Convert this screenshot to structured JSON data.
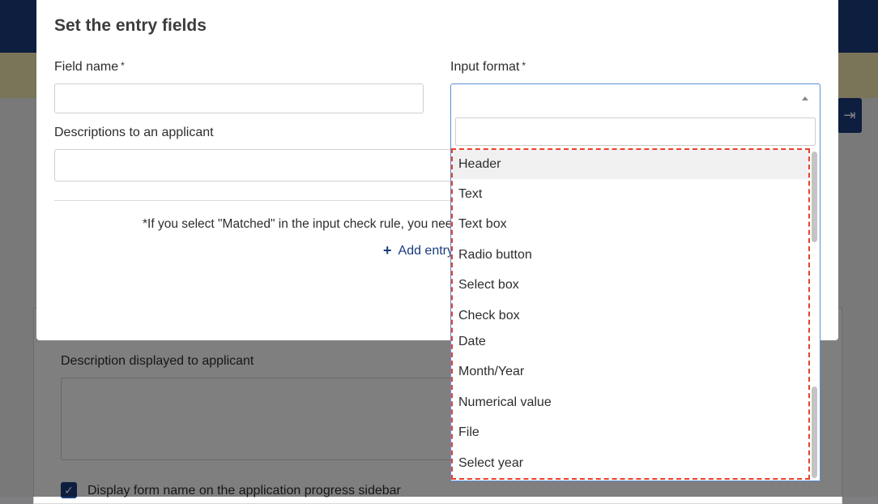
{
  "modal": {
    "title": "Set the entry fields",
    "field_name_label": "Field name",
    "input_format_label": "Input format",
    "required_mark": "*",
    "descriptions_label": "Descriptions to an applicant",
    "note": "*If you select \"Matched\" in the input check rule, you need",
    "add_entry_label": "Add entry",
    "plus_icon": "+"
  },
  "dropdown": {
    "selected_value": "",
    "options": [
      "Header",
      "Text",
      "Text box",
      "Radio button",
      "Select box",
      "Check box",
      "Date",
      "Month/Year",
      "Numerical value",
      "File",
      "Select year"
    ],
    "highlighted_index": 0
  },
  "background": {
    "description_label": "Description displayed to applicant",
    "checkbox_label": "Display form name on the application progress sidebar",
    "checkbox_checked": true,
    "side_icon": "⇥"
  },
  "colors": {
    "brand_navy": "#1a3d7c",
    "focus_blue": "#5b8fd6",
    "highlight_dashed": "#e8402b",
    "banner_yellow": "#f5e8b3"
  }
}
